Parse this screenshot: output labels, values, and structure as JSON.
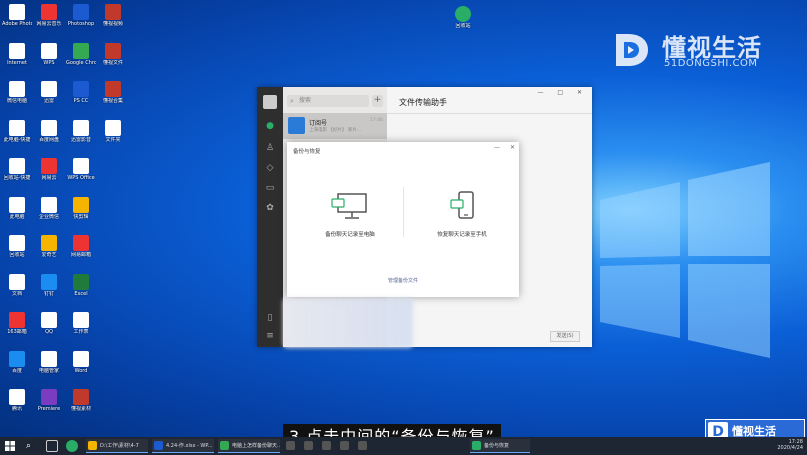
{
  "watermark": {
    "title": "懂视生活",
    "subtitle": "51DONGSHI.COM"
  },
  "desktop_icons": [
    {
      "label": "Adobe Photosho",
      "color": "#ffffff"
    },
    {
      "label": "Internet",
      "color": "#ffffff"
    },
    {
      "label": "微信电脑",
      "color": "#ffffff"
    },
    {
      "label": "此电脑-快捷",
      "color": "#ffffff"
    },
    {
      "label": "回收站-快捷",
      "color": "#ffffff"
    },
    {
      "label": "此电脑",
      "color": "#ffffff"
    },
    {
      "label": "回收站",
      "color": "#ffffff"
    },
    {
      "label": "文档",
      "color": "#ffffff"
    },
    {
      "label": "163邮箱",
      "color": "#e33"
    },
    {
      "label": "百度",
      "color": "#1b8cf0"
    },
    {
      "label": "腾讯",
      "color": "#ffffff"
    },
    {
      "label": "网易云音乐",
      "color": "#e33"
    },
    {
      "label": "WPS",
      "color": "#ffffff"
    },
    {
      "label": "迅雷",
      "color": "#ffffff"
    },
    {
      "label": "百度网盘",
      "color": "#ffffff"
    },
    {
      "label": "网易云",
      "color": "#e33"
    },
    {
      "label": "企业微信",
      "color": "#ffffff"
    },
    {
      "label": "爱奇艺",
      "color": "#f4b400"
    },
    {
      "label": "钉钉",
      "color": "#1b8cf0"
    },
    {
      "label": "QQ",
      "color": "#ffffff"
    },
    {
      "label": "电脑管家",
      "color": "#ffffff"
    },
    {
      "label": "Premiere",
      "color": "#7a3cc0"
    },
    {
      "label": "Photoshop",
      "color": "#1b5ad0"
    },
    {
      "label": "Google Chrome",
      "color": "#34a853"
    },
    {
      "label": "PS CC",
      "color": "#1b5ad0"
    },
    {
      "label": "迅雷影音",
      "color": "#ffffff"
    },
    {
      "label": "WPS Office",
      "color": "#ffffff"
    },
    {
      "label": "快剪辑",
      "color": "#f4b400"
    },
    {
      "label": "网易邮箱",
      "color": "#e33"
    },
    {
      "label": "Excel",
      "color": "#1f7a3c"
    },
    {
      "label": "工作表",
      "color": "#ffffff"
    },
    {
      "label": "Word",
      "color": "#ffffff"
    },
    {
      "label": "懂视素材",
      "color": "#c0392b"
    },
    {
      "label": "懂视视频",
      "color": "#c0392b"
    },
    {
      "label": "懂视文件",
      "color": "#c0392b"
    },
    {
      "label": "懂视合集",
      "color": "#c0392b"
    },
    {
      "label": "文件夹",
      "color": "#ffffff"
    }
  ],
  "recycle_icon": {
    "label": "回收站"
  },
  "wechat": {
    "search_placeholder": "搜索",
    "plus": "+",
    "chat_name": "订阅号",
    "chat_preview": "上海电影 【好片】 新片...",
    "chat_time": "17:46",
    "title": "文件传输助手",
    "controls": "— □ ✕",
    "send_label": "发送(S)"
  },
  "dialog": {
    "title": "备份与恢复",
    "min": "—",
    "close": "✕",
    "option_backup": "备份聊天记录至电脑",
    "option_restore": "恢复聊天记录至手机",
    "manage_link": "管理备份文件"
  },
  "caption": "3.点击中间的“备份与恢复”",
  "taskbar": {
    "items": [
      {
        "label": "D:\\工作\\素材\\4-7",
        "color": "#f4b400"
      },
      {
        "label": "4.24-作.xlsx - WP...",
        "color": "#1b5ad0"
      },
      {
        "label": "电脑上怎样备份聊天...",
        "color": "#34a853"
      },
      {
        "label": "",
        "color": "#555"
      },
      {
        "label": "",
        "color": "#555"
      },
      {
        "label": "",
        "color": "#555"
      },
      {
        "label": "",
        "color": "#555"
      },
      {
        "label": "",
        "color": "#555"
      },
      {
        "label": "备份与恢复",
        "color": "#2aae67"
      }
    ],
    "time": "17:28",
    "date": "2020/4/24"
  },
  "brand_box": {
    "letter": "D",
    "text": "懂视生活"
  },
  "colors": {
    "wechat_green": "#2aae67",
    "desktop_blue": "#0b5fd6",
    "link_blue": "#576b95"
  }
}
